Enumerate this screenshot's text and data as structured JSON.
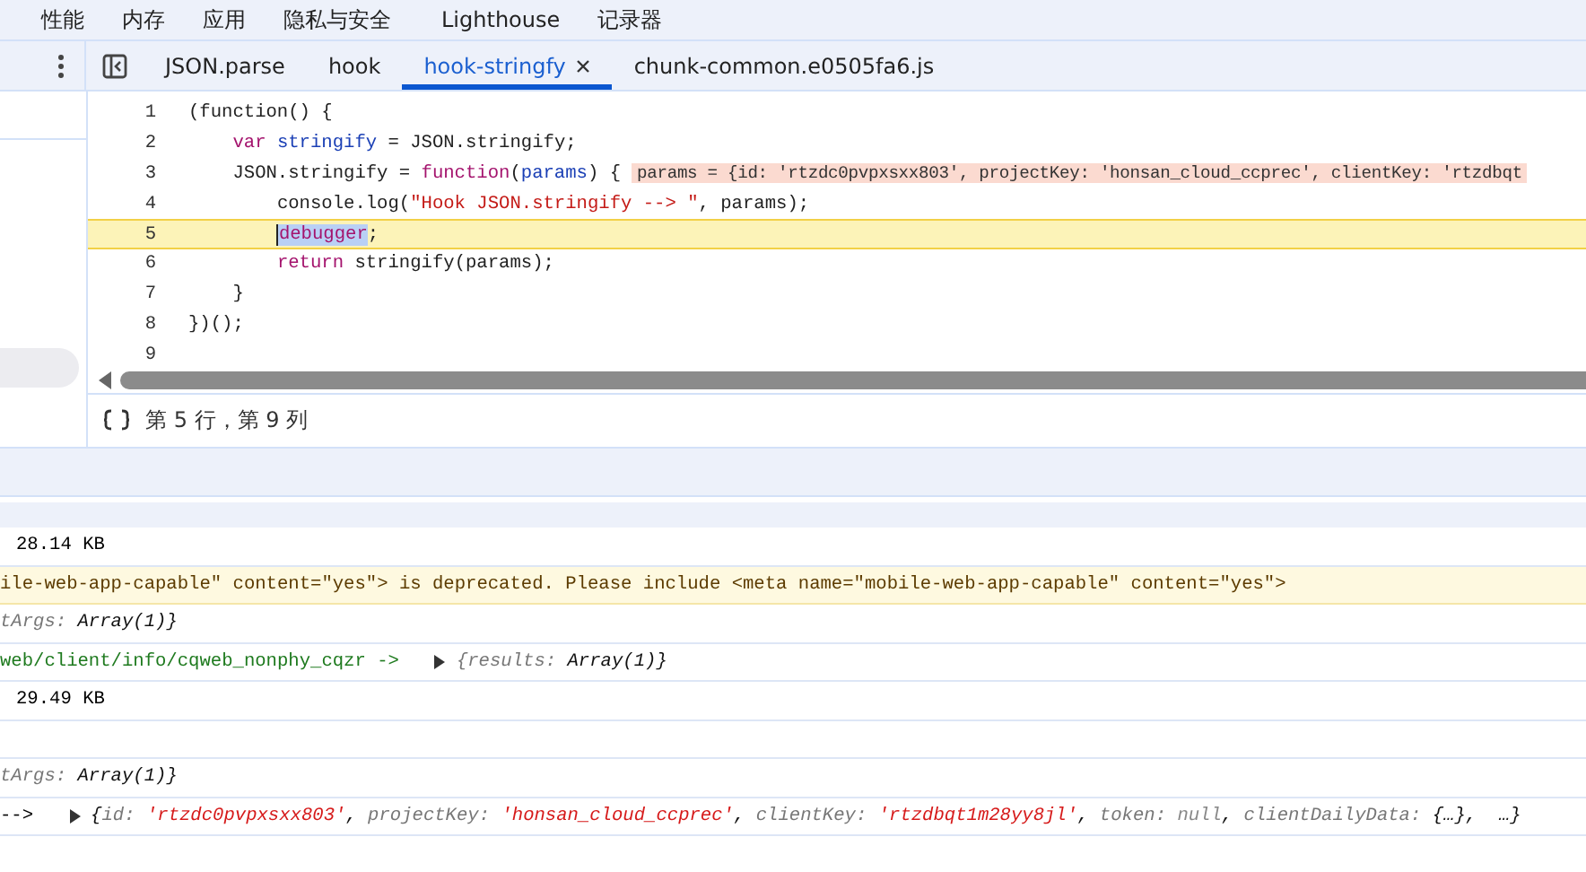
{
  "menu": [
    {
      "label": "性能"
    },
    {
      "label": "内存"
    },
    {
      "label": "应用"
    },
    {
      "label": "隐私与安全"
    },
    {
      "label": "Lighthouse"
    },
    {
      "label": "记录器"
    }
  ],
  "tabs": [
    {
      "label": "JSON.parse",
      "selected": false,
      "closable": false
    },
    {
      "label": "hook",
      "selected": false,
      "closable": false
    },
    {
      "label": "hook-stringfy",
      "selected": true,
      "closable": true
    },
    {
      "label": "chunk-common.e0505fa6.js",
      "selected": false,
      "closable": false
    }
  ],
  "code": [
    {
      "number": "1",
      "highlighted": false,
      "tokens": [
        {
          "kind": "plain",
          "text": "(function() {"
        }
      ]
    },
    {
      "number": "2",
      "highlighted": false,
      "tokens": [
        {
          "kind": "keyword",
          "text": "    var"
        },
        {
          "kind": "def",
          "text": " stringify"
        },
        {
          "kind": "plain",
          "text": " = JSON.stringify;"
        }
      ]
    },
    {
      "number": "3",
      "highlighted": false,
      "tokens": [
        {
          "kind": "plain",
          "text": "    JSON.stringify = "
        },
        {
          "kind": "keyword",
          "text": "function"
        },
        {
          "kind": "plain",
          "text": "("
        },
        {
          "kind": "def",
          "text": "params"
        },
        {
          "kind": "plain",
          "text": ") {"
        },
        {
          "kind": "inline",
          "text": "params = {id: 'rtzdc0pvpxsxx803', projectKey: 'honsan_cloud_ccprec', clientKey: 'rtzdbqt"
        }
      ]
    },
    {
      "number": "4",
      "highlighted": false,
      "tokens": [
        {
          "kind": "plain",
          "text": "        console.log("
        },
        {
          "kind": "string",
          "text": "\"Hook JSON.stringify --> \""
        },
        {
          "kind": "plain",
          "text": ", params);"
        }
      ]
    },
    {
      "number": "5",
      "highlighted": true,
      "tokens": [
        {
          "kind": "selected",
          "text": "        debugger"
        },
        {
          "kind": "plain",
          "text": ";"
        }
      ]
    },
    {
      "number": "6",
      "highlighted": false,
      "tokens": [
        {
          "kind": "keyword",
          "text": "        return"
        },
        {
          "kind": "plain",
          "text": " stringify(params);"
        }
      ]
    },
    {
      "number": "7",
      "highlighted": false,
      "tokens": [
        {
          "kind": "plain",
          "text": "    }"
        }
      ]
    },
    {
      "number": "8",
      "highlighted": false,
      "tokens": [
        {
          "kind": "plain",
          "text": "})();"
        }
      ]
    },
    {
      "number": "9",
      "highlighted": false
    }
  ],
  "status": {
    "position": "第 5 行，第 9 列"
  },
  "console": [
    {
      "kind": "plain",
      "parts": [
        {
          "kind": "plain",
          "text": "28.14 KB"
        }
      ]
    },
    {
      "kind": "warning",
      "parts": [
        {
          "kind": "plain",
          "text": "ile-web-app-capable\" content=\"yes\"> is deprecated. Please include <meta name=\"mobile-web-app-capable\" content=\"yes\">"
        }
      ]
    },
    {
      "kind": "plain",
      "parts": [
        {
          "kind": "key",
          "text": "tArgs:"
        },
        {
          "kind": "value",
          "text": " Array(1)}"
        }
      ]
    },
    {
      "kind": "plain",
      "parts": [
        {
          "kind": "link",
          "text": "web/client/info/cqweb_nonphy_cqzr ->"
        },
        {
          "kind": "expander"
        },
        {
          "kind": "key",
          "text": "{results:"
        },
        {
          "kind": "value",
          "text": " Array(1)}"
        }
      ]
    },
    {
      "kind": "plain",
      "parts": [
        {
          "kind": "plain",
          "text": "29.49 KB"
        }
      ]
    },
    {
      "kind": "empty"
    },
    {
      "kind": "plain",
      "parts": [
        {
          "kind": "key",
          "text": "tArgs:"
        },
        {
          "kind": "value",
          "text": " Array(1)}"
        }
      ]
    },
    {
      "kind": "plain",
      "parts": [
        {
          "kind": "plain",
          "text": "-->"
        },
        {
          "kind": "expander"
        },
        {
          "kind": "value",
          "text": "{"
        },
        {
          "kind": "key",
          "text": "id:"
        },
        {
          "kind": "string",
          "text": " 'rtzdc0pvpxsxx803'"
        },
        {
          "kind": "value",
          "text": ","
        },
        {
          "kind": "key",
          "text": " projectKey:"
        },
        {
          "kind": "string",
          "text": " 'honsan_cloud_ccprec'"
        },
        {
          "kind": "value",
          "text": ","
        },
        {
          "kind": "key",
          "text": " clientKey:"
        },
        {
          "kind": "string",
          "text": " 'rtzdbqt1m28yy8jl'"
        },
        {
          "kind": "value",
          "text": ","
        },
        {
          "kind": "key",
          "text": " token:"
        },
        {
          "kind": "null",
          "text": " null"
        },
        {
          "kind": "value",
          "text": ","
        },
        {
          "kind": "key",
          "text": " clientDailyData:"
        },
        {
          "kind": "value",
          "text": " {…},  …}"
        }
      ]
    }
  ]
}
